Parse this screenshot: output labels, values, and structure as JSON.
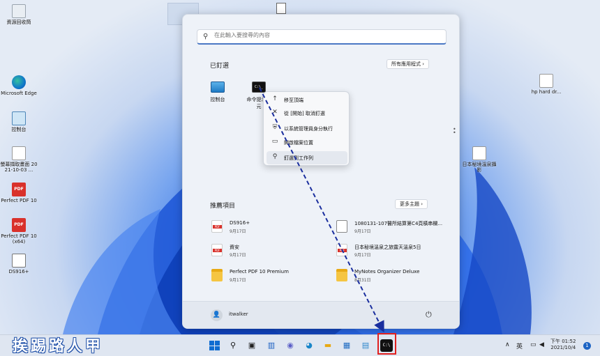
{
  "desktop": {
    "icons_left": [
      {
        "label": "資源回收筒",
        "icon": "recycle-bin-icon"
      },
      {
        "label": "Microsoft Edge",
        "icon": "edge-icon"
      },
      {
        "label": "控制台",
        "icon": "control-panel-icon"
      },
      {
        "label": "螢幕擷取畫面 2021-10-03 ...",
        "icon": "screenshot-file-icon"
      },
      {
        "label": "Perfect PDF 10",
        "icon": "pdf-icon"
      },
      {
        "label": "Perfect PDF 10 (x64)",
        "icon": "pdf-icon"
      },
      {
        "label": "DS916+",
        "icon": "nas-icon"
      }
    ],
    "icons_right": [
      {
        "label": "hp hard dr...",
        "icon": "document-icon"
      },
      {
        "label": "日本秘境溫泉攝影",
        "icon": "photo-icon"
      }
    ]
  },
  "start_menu": {
    "search_placeholder": "在此輸入要搜尋的內容",
    "pinned_title": "已釘選",
    "all_apps_label": "所有應用程式  ›",
    "pinned": [
      {
        "label": "控制台",
        "icon": "control-panel-icon"
      },
      {
        "label": "命令提示字元",
        "icon": "command-prompt-icon",
        "glyph": "C:\\_"
      }
    ],
    "recommended_title": "推薦項目",
    "more_label": "更多主題  ›",
    "recommended": [
      {
        "title": "DS916+",
        "date": "9月17日",
        "icon": "pdf-file-icon"
      },
      {
        "title": "1080131-107醫所結算第C4頁橫串欄...",
        "date": "9月17日",
        "icon": "file-icon"
      },
      {
        "title": "資安",
        "date": "9月17日",
        "icon": "pdf-file-icon"
      },
      {
        "title": "日本秘境溫泉之旅露天溫泉5日",
        "date": "9月17日",
        "icon": "pdf-file-icon"
      },
      {
        "title": "Perfect PDF 10 Premium",
        "date": "9月17日",
        "icon": "folder-icon"
      },
      {
        "title": "MyNotes Organizer Deluxe",
        "date": "8月31日",
        "icon": "folder-icon"
      }
    ],
    "user_name": "itwalker"
  },
  "context_menu": {
    "items": [
      {
        "label": "移至頂端",
        "icon": "arrow-up-icon",
        "glyph": "↑"
      },
      {
        "label": "從 [開始] 取消釘選",
        "icon": "unpin-icon",
        "glyph": "✕"
      },
      {
        "label": "以系統管理員身分執行",
        "icon": "shield-icon",
        "glyph": "⛨"
      },
      {
        "label": "開啟檔案位置",
        "icon": "folder-open-icon",
        "glyph": "▭"
      },
      {
        "label": "釘選到工作列",
        "icon": "pin-icon",
        "glyph": "⚲"
      }
    ]
  },
  "taskbar": {
    "apps": [
      {
        "name": "start-button",
        "glyph": ""
      },
      {
        "name": "search-icon",
        "glyph": "⚲"
      },
      {
        "name": "task-view-icon",
        "glyph": "▣"
      },
      {
        "name": "widgets-icon",
        "glyph": "▥"
      },
      {
        "name": "teams-chat-icon",
        "glyph": "◉"
      },
      {
        "name": "edge-icon",
        "glyph": "◕"
      },
      {
        "name": "file-explorer-icon",
        "glyph": "▬"
      },
      {
        "name": "store-icon",
        "glyph": "▦"
      },
      {
        "name": "control-panel-icon",
        "glyph": "▤"
      },
      {
        "name": "command-prompt-icon",
        "glyph": "C:\\"
      }
    ],
    "tray_chevron": "∧",
    "ime": "英",
    "clock_time": "下午 01:52",
    "clock_date": "2021/10/4",
    "notifications": "1"
  },
  "watermark": "挨踢路人甲",
  "colors": {
    "accent": "#0f6cd1",
    "highlight_box": "#e02020",
    "arrow": "#1a2e9e"
  }
}
